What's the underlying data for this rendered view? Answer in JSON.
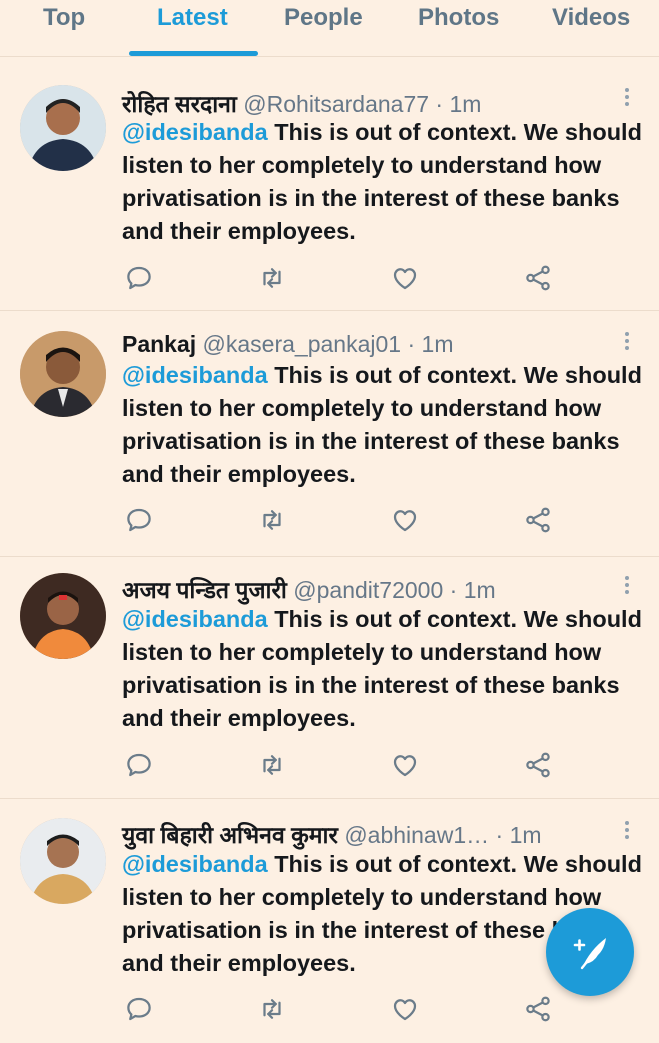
{
  "tabs": [
    {
      "label": "Top"
    },
    {
      "label": "Latest",
      "active": true
    },
    {
      "label": "People"
    },
    {
      "label": "Photos"
    },
    {
      "label": "Videos"
    }
  ],
  "tweets": [
    {
      "name": "रोहित सरदाना",
      "handle": "@Rohitsardana77",
      "time": "· 1m",
      "mention": "@idesibanda",
      "text": " This is out of context. We should listen to her completely to understand how privatisation is in the interest of these banks and their employees."
    },
    {
      "name": "Pankaj",
      "handle": "@kasera_pankaj01",
      "time": "· 1m",
      "mention": "@idesibanda",
      "text": " This is out of context. We should listen to her completely to understand how privatisation is in the interest of these banks and their employees."
    },
    {
      "name": "अजय पन्डित पुजारी",
      "handle": "@pandit72000",
      "time": "· 1m",
      "mention": "@idesibanda",
      "text": " This is out of context. We should listen to her completely to understand how privatisation is in the interest of these banks and their employees."
    },
    {
      "name": "युवा बिहारी अभिनव कुमार",
      "handle": "@abhinaw1…",
      "time": "· 1m",
      "mention": "@idesibanda",
      "text": " This is out of context. We should listen to her completely to understand how privatisation is in the interest of these banks and their employees."
    }
  ],
  "icons": {
    "reply": "reply-icon",
    "retweet": "retweet-icon",
    "like": "like-icon",
    "share": "share-icon",
    "compose": "compose-tweet-icon"
  },
  "colors": {
    "accent": "#1d9bd8",
    "background": "#fdf0e3",
    "text": "#15181c",
    "muted": "#667788"
  }
}
